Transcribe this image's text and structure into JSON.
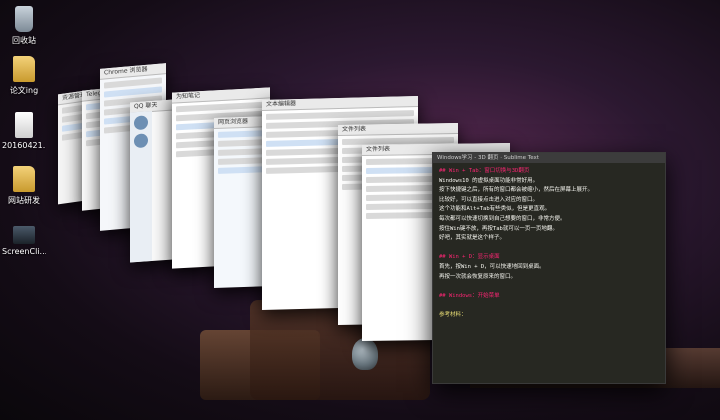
{
  "desktop": {
    "icons": [
      {
        "label": "回收站",
        "icon": "recycle-bin-icon"
      },
      {
        "label": "论文ing",
        "icon": "folder-icon"
      },
      {
        "label": "20160421...",
        "icon": "document-icon"
      },
      {
        "label": "网站研发",
        "icon": "folder-icon"
      },
      {
        "label": "ScreenCli...",
        "icon": "app-icon"
      }
    ]
  },
  "editor": {
    "title": "Windows学习 - 3D 翻页 · Sublime Text",
    "lines": [
      {
        "kind": "h",
        "text": "## Win + Tab：窗口切换与3D翻页"
      },
      {
        "kind": "n",
        "text": "Windows10 的虚拟桌面功能非常好用。"
      },
      {
        "kind": "n",
        "text": "按下快捷键之后，所有的窗口都会被缩小，然后在屏幕上展开。"
      },
      {
        "kind": "n",
        "text": "比较好，可以直接点击进入对应的窗口。"
      },
      {
        "kind": "n",
        "text": "这个功能和Alt+Tab有些类似，但是更直观。"
      },
      {
        "kind": "n",
        "text": "每次都可以快速切换到自己想要的窗口，非常方便。"
      },
      {
        "kind": "n",
        "text": "按住Win键不放，再按Tab就可以一页一页地翻。"
      },
      {
        "kind": "n",
        "text": "好吧，其实就是这个样子。"
      },
      {
        "kind": "n",
        "text": ""
      },
      {
        "kind": "h",
        "text": "## Win + D：显示桌面"
      },
      {
        "kind": "n",
        "text": "首先，按Win + D，可以快速地回到桌面。"
      },
      {
        "kind": "n",
        "text": "再按一次就会恢复原来的窗口。"
      },
      {
        "kind": "n",
        "text": ""
      },
      {
        "kind": "h",
        "text": "## Windows：开始菜单"
      },
      {
        "kind": "n",
        "text": ""
      },
      {
        "kind": "t",
        "text": "参考材料："
      }
    ]
  },
  "windows": [
    {
      "title": "资源管理器"
    },
    {
      "title": "Telegram"
    },
    {
      "title": "Chrome 浏览器"
    },
    {
      "title": "QQ 聊天"
    },
    {
      "title": "为知笔记"
    },
    {
      "title": "网页浏览器"
    },
    {
      "title": "文本编辑器"
    },
    {
      "title": "文件列表"
    }
  ]
}
